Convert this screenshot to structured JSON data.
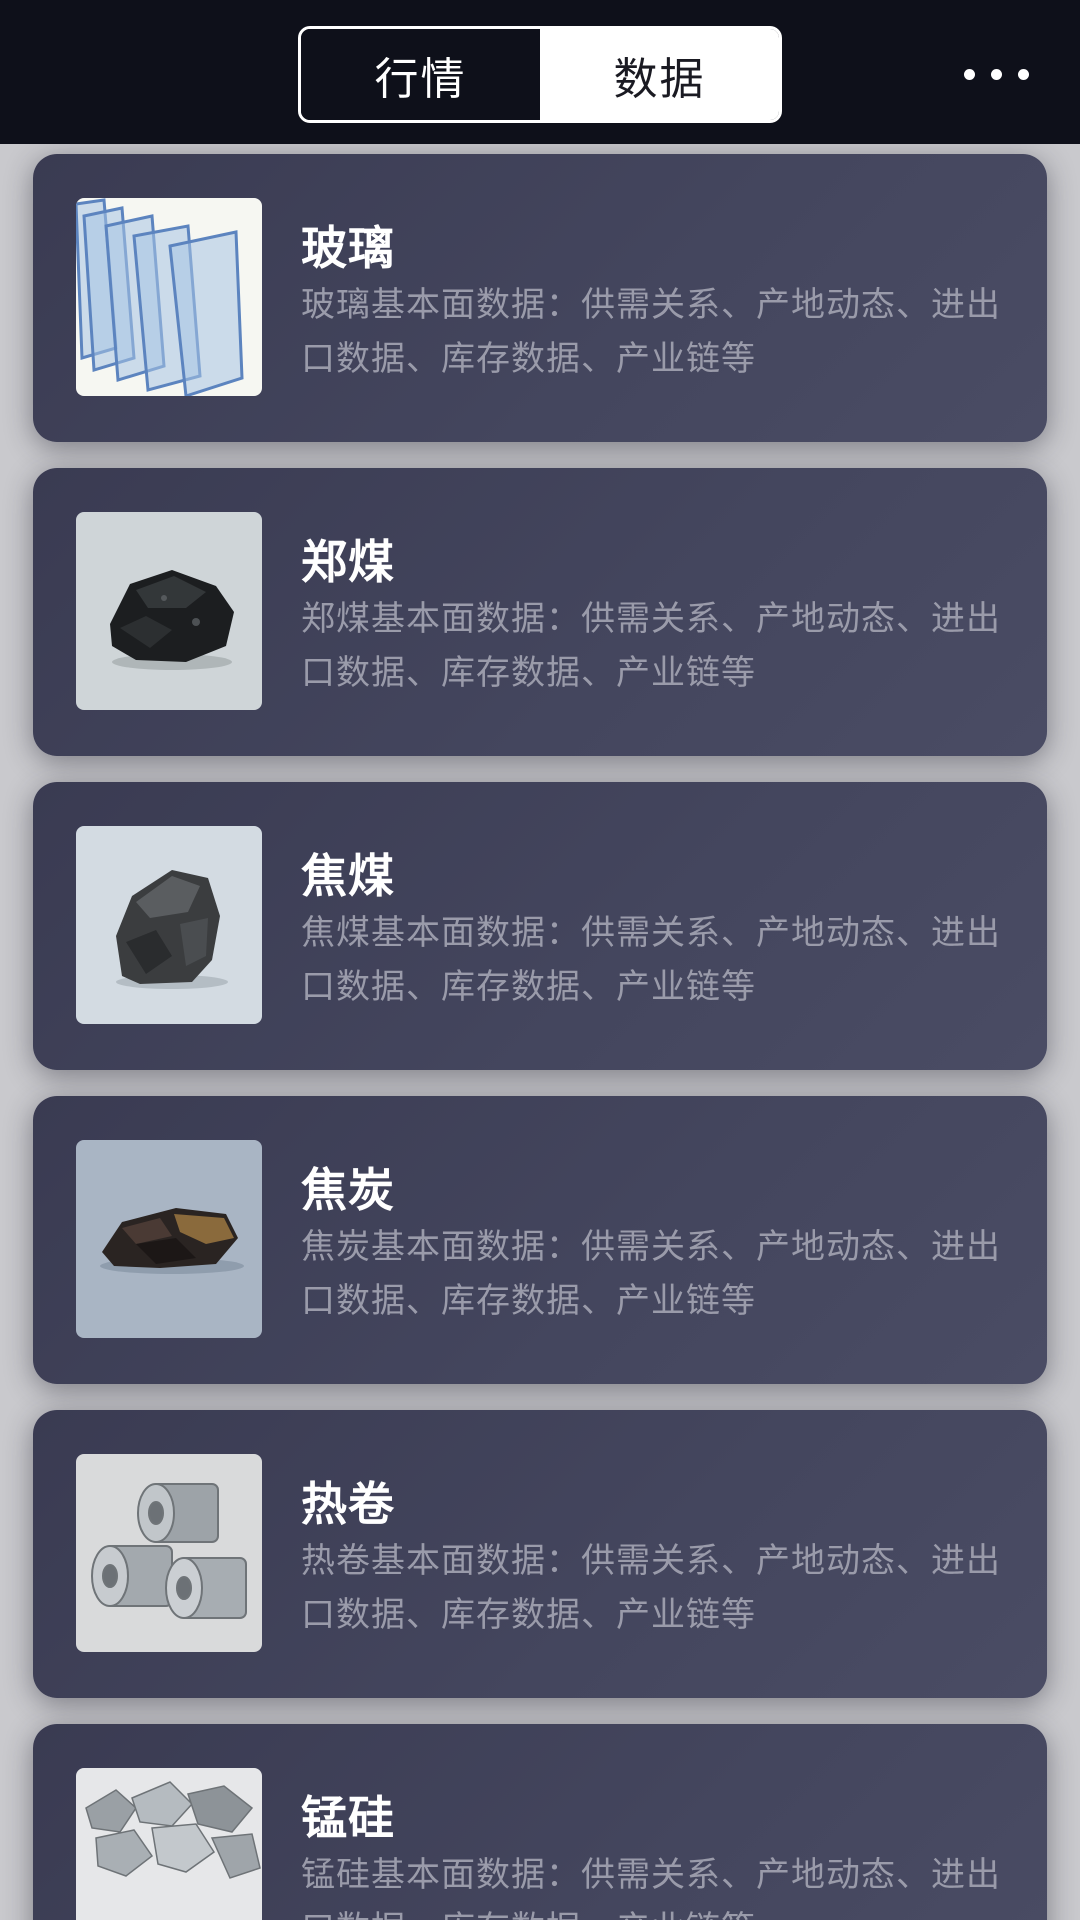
{
  "header": {
    "tabs": [
      {
        "label": "行情",
        "active": true
      },
      {
        "label": "数据",
        "active": false
      }
    ],
    "more_icon": "more-dots-icon"
  },
  "colors": {
    "header_bg": "#0e101a",
    "card_bg": "#3f4158",
    "title": "#ffffff",
    "desc": "#9a9baa"
  },
  "items": [
    {
      "title": "玻璃",
      "desc": "玻璃基本面数据：供需关系、产地动态、进出口数据、库存数据、产业链等",
      "icon": "glass-panes-image"
    },
    {
      "title": "郑煤",
      "desc": "郑煤基本面数据：供需关系、产地动态、进出口数据、库存数据、产业链等",
      "icon": "coal-lump-image"
    },
    {
      "title": "焦煤",
      "desc": "焦煤基本面数据：供需关系、产地动态、进出口数据、库存数据、产业链等",
      "icon": "coking-coal-image"
    },
    {
      "title": "焦炭",
      "desc": "焦炭基本面数据：供需关系、产地动态、进出口数据、库存数据、产业链等",
      "icon": "coke-image"
    },
    {
      "title": "热卷",
      "desc": "热卷基本面数据：供需关系、产地动态、进出口数据、库存数据、产业链等",
      "icon": "steel-coils-image"
    },
    {
      "title": "锰硅",
      "desc": "锰硅基本面数据：供需关系、产地动态、进出口数据、库存数据、产业链等",
      "icon": "silicomanganese-image"
    }
  ]
}
